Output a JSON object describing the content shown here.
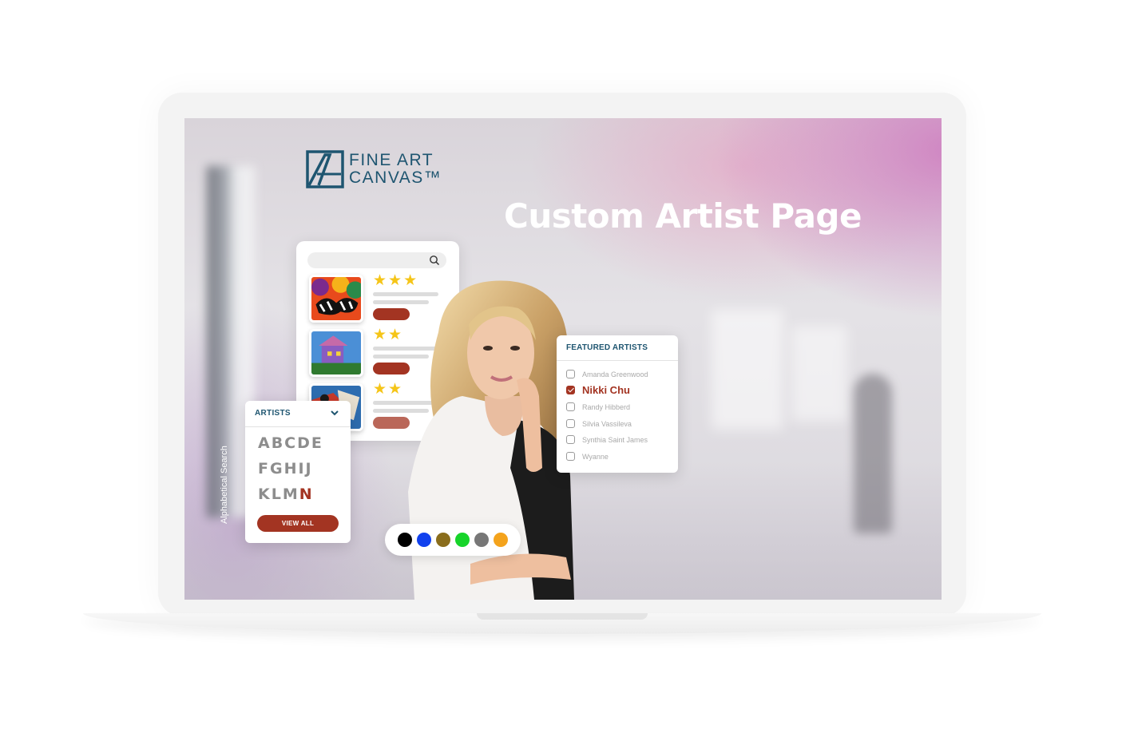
{
  "logo": {
    "line1": "FINE ART",
    "line2": "CANVAS™"
  },
  "headline": "Custom Artist Page",
  "alpha_panel": {
    "header": "ARTISTS",
    "rows": [
      "ABCDE",
      "FGHIJ",
      "KLM"
    ],
    "highlight_letter": "N",
    "view_all": "VIEW ALL",
    "side_label": "Alphabetical Search"
  },
  "featured_artists": {
    "title": "FEATURED ARTISTS",
    "items": [
      {
        "name": "Amanda Greenwood",
        "checked": false
      },
      {
        "name": "Nikki Chu",
        "checked": true
      },
      {
        "name": "Randy Hibberd",
        "checked": false
      },
      {
        "name": "Silvia Vassileva",
        "checked": false
      },
      {
        "name": "Synthia Saint James",
        "checked": false
      },
      {
        "name": "Wyanne",
        "checked": false
      }
    ]
  },
  "product_card": {
    "items": [
      {
        "stars": "★★★"
      },
      {
        "stars": "★★"
      },
      {
        "stars": "★★"
      }
    ]
  },
  "color_swatches": [
    "#000000",
    "#1141ee",
    "#8a6d1c",
    "#17d42a",
    "#777777",
    "#f4a31c"
  ],
  "colors": {
    "accent": "#a33422",
    "brand": "#1e5570",
    "star": "#f5c518"
  }
}
